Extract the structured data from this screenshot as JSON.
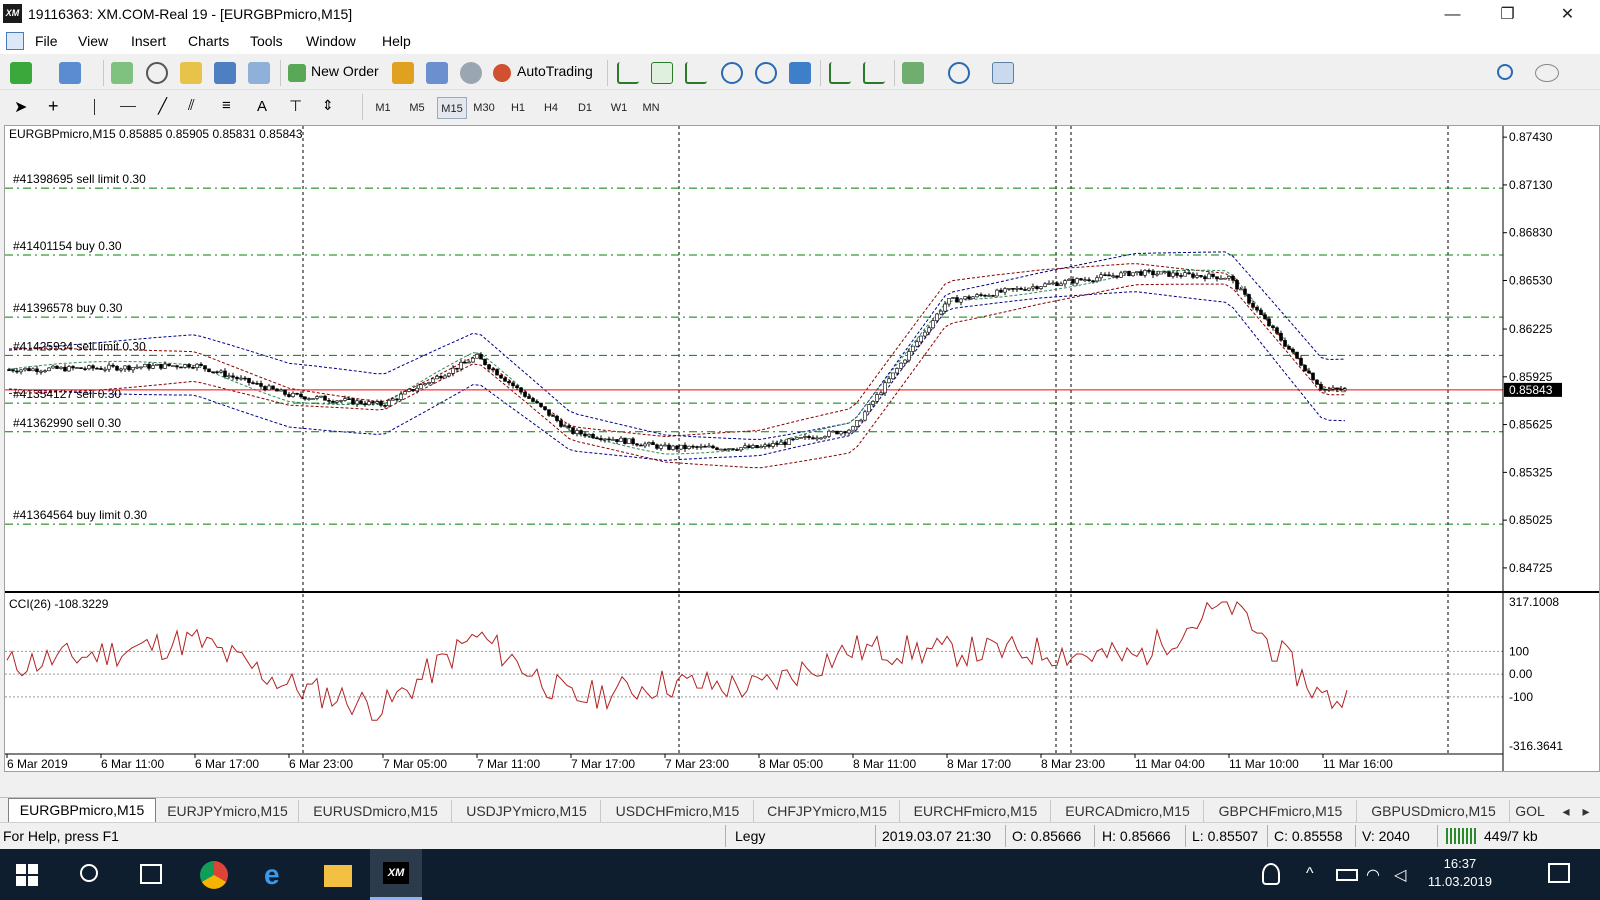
{
  "window": {
    "title": "19116363: XM.COM-Real 19 - [EURGBPmicro,M15]",
    "logo_text": "XM",
    "controls": [
      "—",
      "❐",
      "✕"
    ]
  },
  "menu": [
    "File",
    "View",
    "Insert",
    "Charts",
    "Tools",
    "Window",
    "Help"
  ],
  "mdi_controls": [
    "–",
    "▫",
    "×"
  ],
  "toolbar": {
    "new_order": "New Order",
    "autotrading": "AutoTrading"
  },
  "timeframes": {
    "items": [
      "M1",
      "M5",
      "M15",
      "M30",
      "H1",
      "H4",
      "D1",
      "W1",
      "MN"
    ],
    "active": "M15"
  },
  "chart_header": "EURGBPmicro,M15  0.85885 0.85905 0.85831 0.85843",
  "current_price": "0.85843",
  "price_ticks": [
    "0.87430",
    "0.87130",
    "0.86830",
    "0.86530",
    "0.86225",
    "0.85925",
    "0.85625",
    "0.85325",
    "0.85025",
    "0.84725"
  ],
  "order_lines": [
    {
      "label": "#41398695 sell limit 0.30",
      "price": 0.8711
    },
    {
      "label": "#41401154 buy 0.30",
      "price": 0.8669
    },
    {
      "label": "#41396578 buy 0.30",
      "price": 0.863
    },
    {
      "label": "#41425934 sell limit 0.30",
      "price": 0.8606
    },
    {
      "label": "#41354127 sell 0.30",
      "price": 0.8576
    },
    {
      "label": "#41362990 sell 0.30",
      "price": 0.8558
    },
    {
      "label": "#41364564 buy limit 0.30",
      "price": 0.85
    }
  ],
  "indicator": {
    "header": "CCI(26) -108.3229",
    "ticks": [
      "317.1008",
      "100",
      "0.00",
      "-100",
      "-316.3641"
    ]
  },
  "time_ticks": [
    "6 Mar 2019",
    "6 Mar 11:00",
    "6 Mar 17:00",
    "6 Mar 23:00",
    "7 Mar 05:00",
    "7 Mar 11:00",
    "7 Mar 17:00",
    "7 Mar 23:00",
    "8 Mar 05:00",
    "8 Mar 11:00",
    "8 Mar 17:00",
    "8 Mar 23:00",
    "11 Mar 04:00",
    "11 Mar 10:00",
    "11 Mar 16:00"
  ],
  "tabs": [
    "EURGBPmicro,M15",
    "EURJPYmicro,M15",
    "EURUSDmicro,M15",
    "USDJPYmicro,M15",
    "USDCHFmicro,M15",
    "CHFJPYmicro,M15",
    "EURCHFmicro,M15",
    "EURCADmicro,M15",
    "GBPCHFmicro,M15",
    "GBPUSDmicro,M15",
    "GOL"
  ],
  "tabs_arrows": [
    "◂",
    "▸"
  ],
  "status": {
    "help": "For Help, press F1",
    "profile": "Legy",
    "datetime": "2019.03.07 21:30",
    "open": "O: 0.85666",
    "high": "H: 0.85666",
    "low": "L: 0.85507",
    "close": "C: 0.85558",
    "volume": "V: 2040",
    "traffic": "449/7 kb"
  },
  "taskbar": {
    "time": "16:37",
    "date": "11.03.2019",
    "xm_label": "XM"
  },
  "chart_data": {
    "type": "candlestick",
    "symbol": "EURGBPmicro",
    "timeframe": "M15",
    "ylim": [
      0.8458,
      0.875
    ],
    "ohlc_last": {
      "open": 0.85885,
      "high": 0.85905,
      "low": 0.85831,
      "close": 0.85843
    },
    "close_path": [
      {
        "t": "6 Mar 2019",
        "price": 0.8597
      },
      {
        "t": "6 Mar 11:00",
        "price": 0.8598
      },
      {
        "t": "6 Mar 17:00",
        "price": 0.86
      },
      {
        "t": "6 Mar 23:00",
        "price": 0.8581
      },
      {
        "t": "7 Mar 05:00",
        "price": 0.8575
      },
      {
        "t": "7 Mar 11:00",
        "price": 0.8605
      },
      {
        "t": "7 Mar 17:00",
        "price": 0.8558
      },
      {
        "t": "7 Mar 23:00",
        "price": 0.8548
      },
      {
        "t": "8 Mar 05:00",
        "price": 0.8548
      },
      {
        "t": "8 Mar 11:00",
        "price": 0.856
      },
      {
        "t": "8 Mar 17:00",
        "price": 0.864
      },
      {
        "t": "8 Mar 23:00",
        "price": 0.865
      },
      {
        "t": "11 Mar 04:00",
        "price": 0.8658
      },
      {
        "t": "11 Mar 10:00",
        "price": 0.8655
      },
      {
        "t": "11 Mar 16:00",
        "price": 0.85843
      }
    ],
    "cci_path": [
      {
        "t": "6 Mar 2019",
        "value": 40
      },
      {
        "t": "6 Mar 11:00",
        "value": 90
      },
      {
        "t": "6 Mar 17:00",
        "value": 150
      },
      {
        "t": "6 Mar 23:00",
        "value": -50
      },
      {
        "t": "7 Mar 05:00",
        "value": -150
      },
      {
        "t": "7 Mar 11:00",
        "value": 170
      },
      {
        "t": "7 Mar 17:00",
        "value": -110
      },
      {
        "t": "7 Mar 23:00",
        "value": -40
      },
      {
        "t": "8 Mar 05:00",
        "value": -60
      },
      {
        "t": "8 Mar 11:00",
        "value": 110
      },
      {
        "t": "8 Mar 17:00",
        "value": 100
      },
      {
        "t": "8 Mar 23:00",
        "value": 100
      },
      {
        "t": "11 Mar 04:00",
        "value": 70
      },
      {
        "t": "11 Mar 10:00",
        "value": 317
      },
      {
        "t": "11 Mar 16:00",
        "value": -108.3229
      }
    ],
    "cci_range": [
      -316.3641,
      317.1008
    ]
  },
  "colors": {
    "order_line": "#008000",
    "price_line": "#ff0000",
    "cci_line": "#b22222",
    "band_blue": "#00008b",
    "band_red": "#8b0000",
    "band_green": "#2e8b57"
  }
}
